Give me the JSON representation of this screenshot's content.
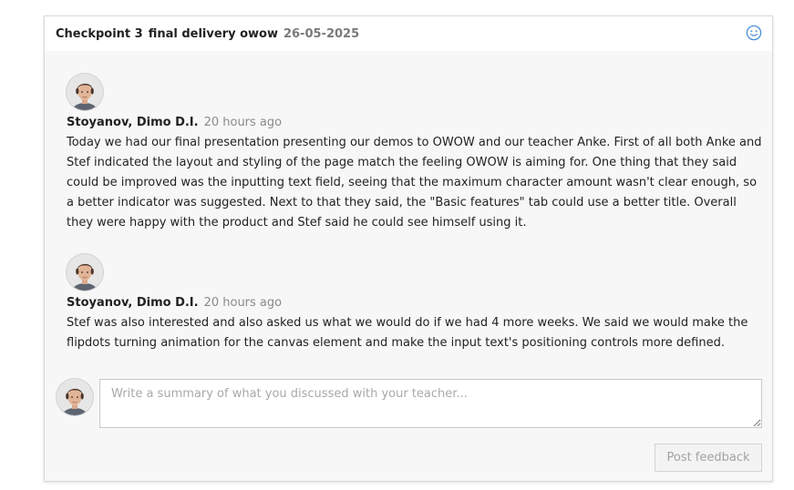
{
  "checkpoint": {
    "title": "Checkpoint 3",
    "subtitle": "final delivery owow",
    "date": "26-05-2025"
  },
  "header_icon": "smiley-face-icon",
  "comments": [
    {
      "author": "Stoyanov, Dimo D.I.",
      "time": "20 hours ago",
      "text": "Today we had our final presentation presenting our demos to OWOW and our teacher Anke. First of all both Anke and Stef indicated the layout and styling of the page match the feeling OWOW is aiming for. One thing that they said could be improved was the inputting text field, seeing that the maximum character amount wasn't clear enough, so a better indicator was suggested. Next to that they said, the \"Basic features\" tab could use a better title. Overall they were happy with the product and Stef said he could see himself using it."
    },
    {
      "author": "Stoyanov, Dimo D.I.",
      "time": "20 hours ago",
      "text": "Stef was also interested and also asked us what we would do if we had 4 more weeks. We said we would make the flipdots turning animation for the canvas element and make the input text's positioning controls more defined."
    }
  ],
  "composer": {
    "placeholder": "Write a summary of what you discussed with your teacher...",
    "value": "",
    "post_label": "Post feedback"
  },
  "colors": {
    "accent": "#4a8fd6",
    "muted_text": "#8a8a8a",
    "panel_background": "#f7f7f7"
  }
}
